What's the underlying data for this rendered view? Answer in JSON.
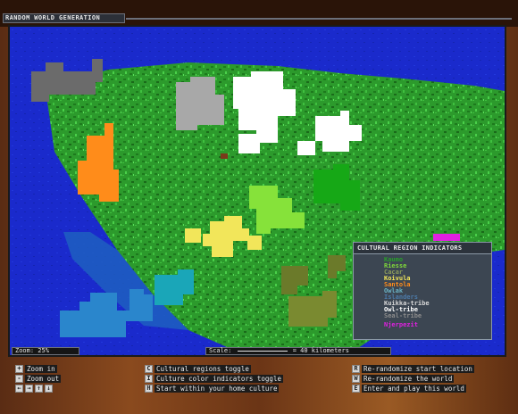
{
  "window": {
    "title": "RANDOM WORLD GENERATION"
  },
  "status": {
    "zoom_text": "Zoom: 25%",
    "scale_prefix": "Scale:",
    "scale_suffix": "= 40 kilometers"
  },
  "legend": {
    "title": "CULTURAL REGION INDICATORS",
    "items": [
      {
        "label": "Kaumo",
        "color": "#2a9d2a"
      },
      {
        "label": "Riesse",
        "color": "#7fd83a"
      },
      {
        "label": "Cacar",
        "color": "#8a9a5a"
      },
      {
        "label": "Koivula",
        "color": "#f2e65a"
      },
      {
        "label": "Santola",
        "color": "#ff8c1a"
      },
      {
        "label": "Owlak",
        "color": "#6ab2c4"
      },
      {
        "label": "Islanders",
        "color": "#4c7aa8"
      },
      {
        "label": "Kuikka-tribe",
        "color": "#d8d8d8"
      },
      {
        "label": "Owl-tribe",
        "color": "#ffffff"
      },
      {
        "label": "Seal-tribe",
        "color": "#8c8c8c"
      },
      {
        "label": "Njerpezit",
        "color": "#e020e0"
      }
    ]
  },
  "help": {
    "zoom_in": "Zoom in",
    "zoom_out": "Zoom out",
    "cultural_toggle": "Cultural regions toggle",
    "culture_color_toggle": "Culture color indicators toggle",
    "start_home": "Start within your home culture",
    "rerandomize_start": "Re-randomize start location",
    "rerandomize_world": "Re-randomize the world",
    "enter_play": "Enter and play this world",
    "keys": {
      "plus": "+",
      "minus": "-",
      "left": "←",
      "right": "→",
      "up": "↑",
      "down": "↓",
      "c": "C",
      "i": "I",
      "h": "H",
      "r": "R",
      "w": "W",
      "e": "E"
    }
  },
  "colors": {
    "ocean": "#1a2acc",
    "land": "#2a9a2a",
    "legend_bg": "#3c4652",
    "frame": "#7a401a"
  }
}
